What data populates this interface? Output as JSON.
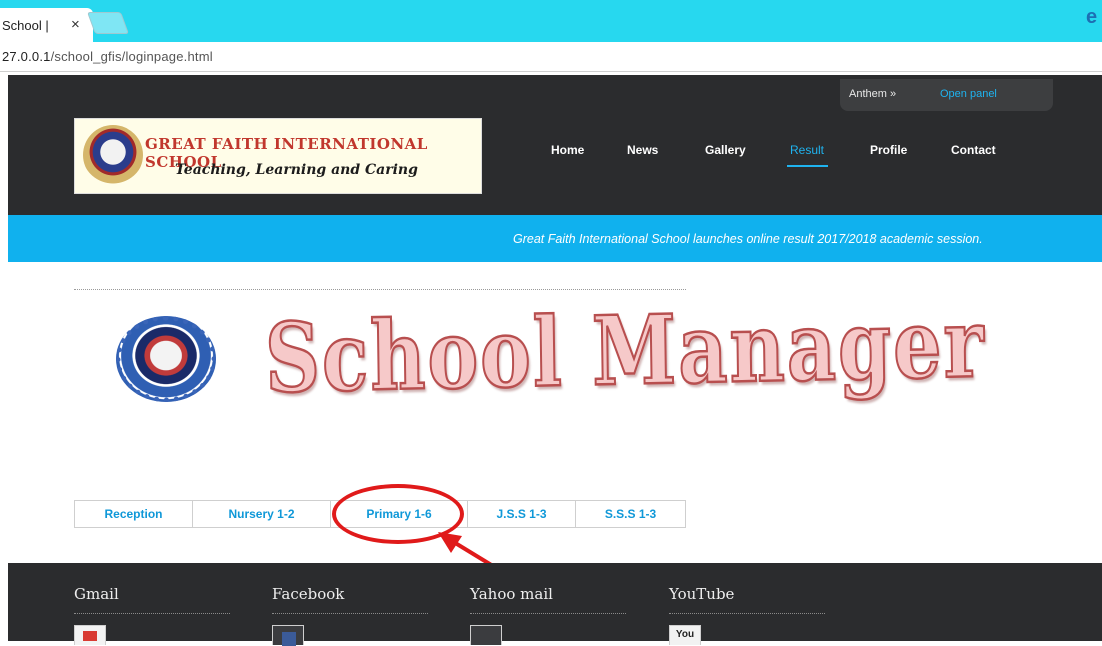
{
  "browser": {
    "tab_title": "School | ",
    "tab_close": "×",
    "url_host": "27.0.0.1",
    "url_path": "/school_gfis/loginpage.html",
    "edge_glyph": "e"
  },
  "header": {
    "anthem_label": "Anthem »",
    "open_panel_label": "Open panel",
    "logo_name": "GREAT FAITH INTERNATIONAL SCHOOL",
    "logo_tagline": "Teaching, Learning and Caring",
    "nav": [
      "Home",
      "News",
      "Gallery",
      "Result",
      "Profile",
      "Contact"
    ],
    "active_nav": "Result"
  },
  "ticker": {
    "text": "Great Faith International School launches online result 2017/2018 academic session."
  },
  "main": {
    "title": "School Manager",
    "levels": [
      "Reception",
      "Nursery 1-2",
      "Primary 1-6",
      "J.S.S 1-3",
      "S.S.S 1-3"
    ],
    "highlighted_level": "Primary 1-6"
  },
  "footer": {
    "columns": [
      "Gmail",
      "Facebook",
      "Yahoo mail",
      "YouTube"
    ],
    "youtube_icon_text": "You"
  },
  "colors": {
    "tabbar": "#27d8ef",
    "header_bg": "#2b2c2e",
    "accent_blue": "#10b1ee",
    "annotation_red": "#e01a1a",
    "title_fill": "#f6c9c9"
  }
}
